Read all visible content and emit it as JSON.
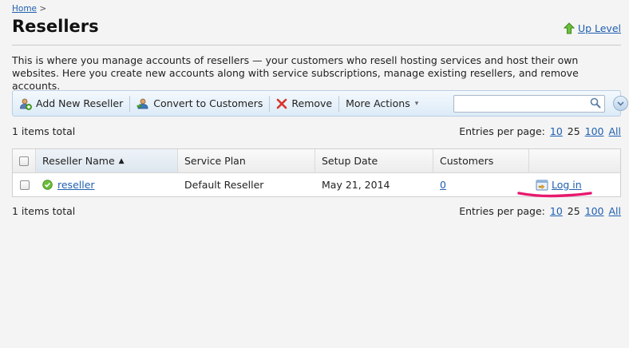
{
  "breadcrumb": {
    "home": "Home",
    "separator": ">"
  },
  "page": {
    "title": "Resellers",
    "up_level": "Up Level"
  },
  "intro": "This is where you manage accounts of resellers — your customers who resell hosting services and host their own websites. Here you create new accounts along with service subscriptions, manage existing resellers, and remove accounts.",
  "toolbar": {
    "add_new_reseller": "Add New Reseller",
    "convert_to_customers": "Convert to Customers",
    "remove": "Remove",
    "more_actions": "More Actions",
    "search_value": ""
  },
  "summary": {
    "items_total": "1 items total",
    "entries_label": "Entries per page:",
    "entries_options": [
      "10",
      "25",
      "100",
      "All"
    ],
    "entries_selected": "25"
  },
  "table": {
    "headers": {
      "name": "Reseller Name",
      "plan": "Service Plan",
      "date": "Setup Date",
      "customers": "Customers"
    },
    "rows": [
      {
        "name": "reseller",
        "plan": "Default Reseller",
        "date": "May 21, 2014",
        "customers": "0",
        "action": "Log in",
        "status": "active"
      }
    ]
  },
  "colors": {
    "link": "#1f5fb0",
    "highlight": "#e8196e",
    "toolbar": "#dcebf7"
  }
}
